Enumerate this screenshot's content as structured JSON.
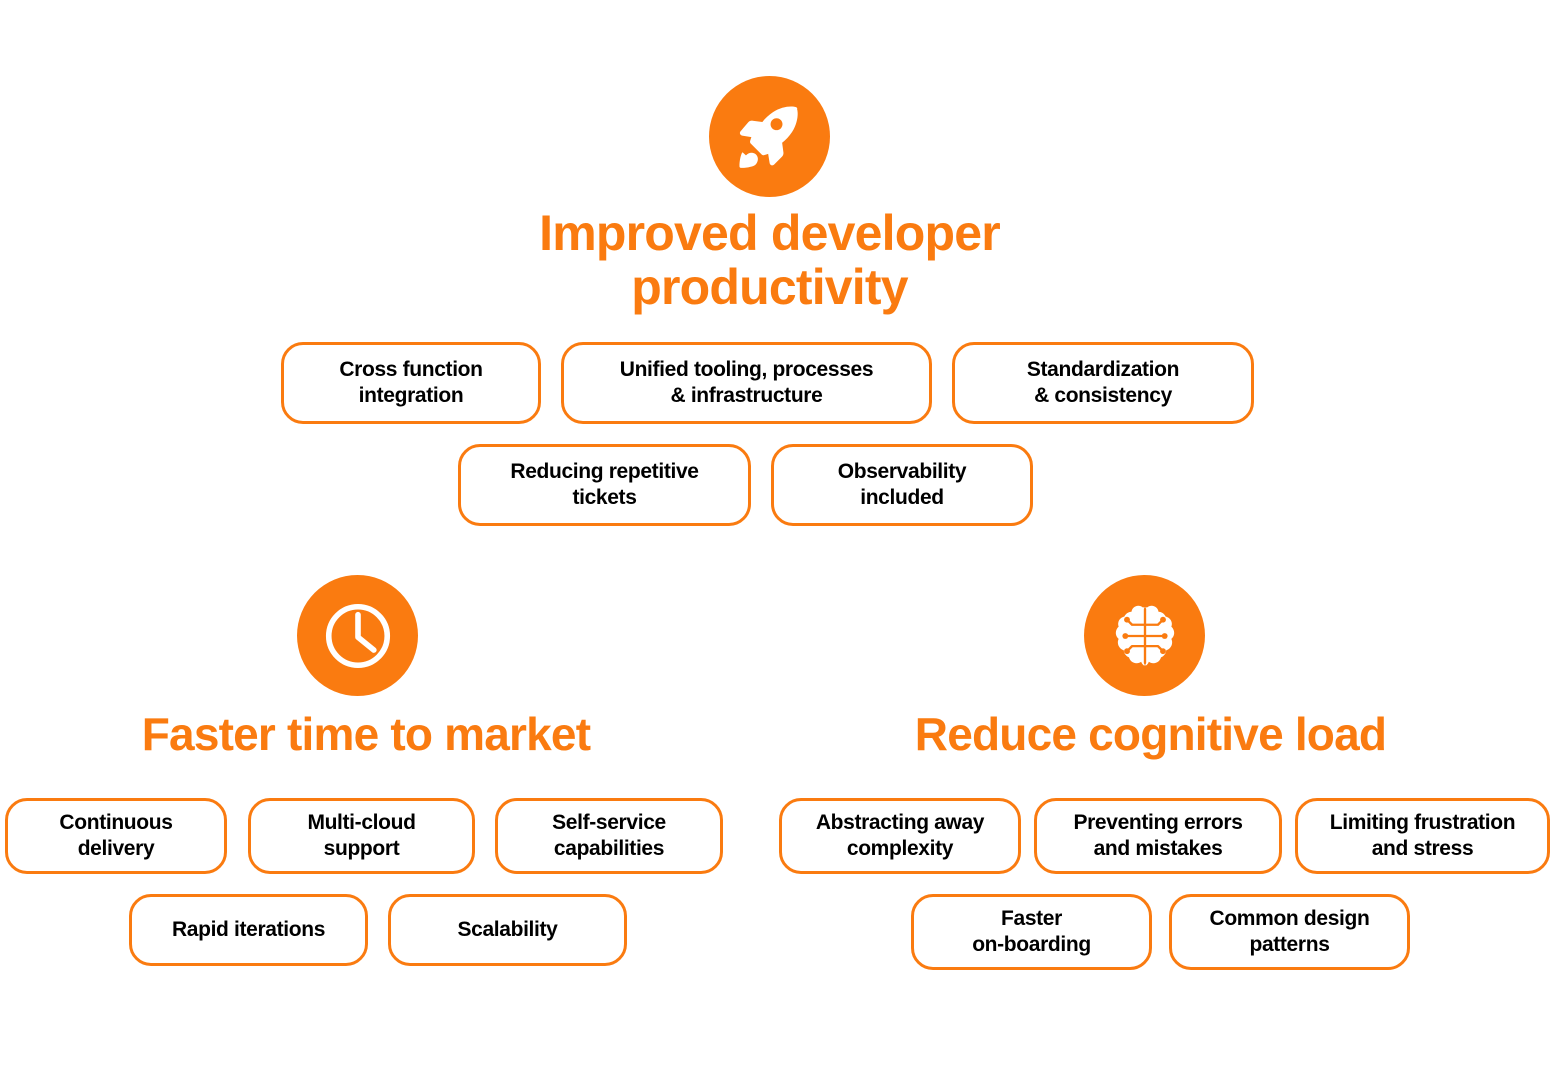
{
  "theme": {
    "accent": "#FA7B10",
    "text": "#000000",
    "background": "#FFFFFF"
  },
  "groups": [
    {
      "id": "improved-developer-productivity",
      "icon": "rocket-icon",
      "heading": "Improved developer\nproductivity",
      "pills": [
        {
          "id": "cross-function-integration",
          "label": "Cross function\nintegration"
        },
        {
          "id": "unified-tooling",
          "label": "Unified tooling, processes\n& infrastructure"
        },
        {
          "id": "standardization-consistency",
          "label": "Standardization\n& consistency"
        },
        {
          "id": "reducing-repetitive-tickets",
          "label": "Reducing repetitive\ntickets"
        },
        {
          "id": "observability-included",
          "label": "Observability\nincluded"
        }
      ]
    },
    {
      "id": "faster-time-to-market",
      "icon": "clock-icon",
      "heading": "Faster time to market",
      "pills": [
        {
          "id": "continuous-delivery",
          "label": "Continuous\ndelivery"
        },
        {
          "id": "multi-cloud-support",
          "label": "Multi-cloud\nsupport"
        },
        {
          "id": "self-service",
          "label": "Self-service\ncapabilities"
        },
        {
          "id": "rapid-iterations",
          "label": "Rapid iterations"
        },
        {
          "id": "scalability",
          "label": "Scalability"
        }
      ]
    },
    {
      "id": "reduce-cognitive-load",
      "icon": "brain-icon",
      "heading": "Reduce cognitive load",
      "pills": [
        {
          "id": "abstracting-away-complexity",
          "label": "Abstracting away\ncomplexity"
        },
        {
          "id": "preventing-errors",
          "label": "Preventing errors\nand mistakes"
        },
        {
          "id": "limiting-frustration",
          "label": "Limiting frustration\nand stress"
        },
        {
          "id": "faster-on-boarding",
          "label": "Faster\non-boarding"
        },
        {
          "id": "common-design-patterns",
          "label": "Common design\npatterns"
        }
      ]
    }
  ]
}
